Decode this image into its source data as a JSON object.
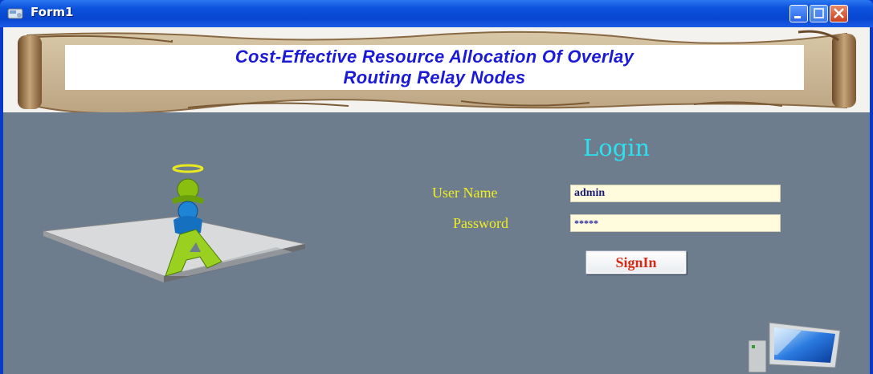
{
  "window": {
    "title": "Form1"
  },
  "banner": {
    "line1": "Cost-Effective Resource Allocation Of Overlay",
    "line2": "Routing Relay Nodes"
  },
  "login": {
    "heading": "Login",
    "username_label": "User Name",
    "username_value": "admin",
    "password_label": "Password",
    "password_value": "*****",
    "signin_label": "SignIn"
  },
  "icons": {
    "app": "form-app-icon",
    "illustration": "admin-figure-illustration",
    "computer": "computer-monitor-icon"
  },
  "colors": {
    "titlebar": "#0846d0",
    "client_bg": "#6e7d8d",
    "login_heading": "#2ee0ee",
    "label": "#f0ee22",
    "field_bg": "#fffbdc",
    "button_text": "#d62a14",
    "banner_text": "#1a1ad8"
  }
}
